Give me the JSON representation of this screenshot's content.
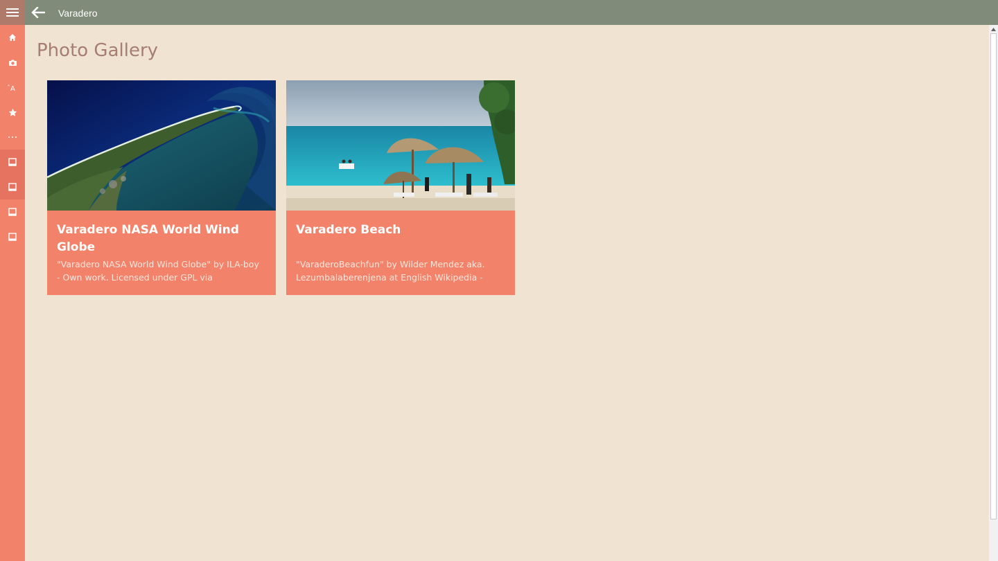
{
  "app": {
    "window_title": "Varadero"
  },
  "icons": {
    "menu": "hamburger-menu-icon",
    "back": "back-arrow-icon"
  },
  "sidebar": {
    "items": [
      {
        "icon": "home-icon",
        "selected": false
      },
      {
        "icon": "camera-icon",
        "selected": false
      },
      {
        "icon": "translate-icon",
        "selected": false
      },
      {
        "icon": "star-icon",
        "selected": false
      },
      {
        "icon": "more-icon",
        "selected": false
      },
      {
        "icon": "tablet-icon",
        "selected": true
      },
      {
        "icon": "tablet-icon",
        "selected": true
      },
      {
        "icon": "tablet-icon",
        "selected": false
      },
      {
        "icon": "tablet-icon",
        "selected": false
      }
    ]
  },
  "main": {
    "page_title": "Photo Gallery",
    "cards": [
      {
        "title": "Varadero NASA World Wind Globe",
        "description": "\"Varadero NASA World Wind Globe\" by ILA-boy - Own work. Licensed under GPL via",
        "image": "satellite-image"
      },
      {
        "title": "Varadero Beach",
        "description": "\"VaraderoBeachfun\" by Wilder Mendez aka. Lezumbalaberenjena at English Wikipedia -",
        "image": "beach-photo"
      }
    ]
  },
  "colors": {
    "titlebar": "#808b7a",
    "sidebar": "#f2826a",
    "background": "#f1e3d1",
    "card": "#f2826a",
    "page_title": "#a57e72"
  }
}
